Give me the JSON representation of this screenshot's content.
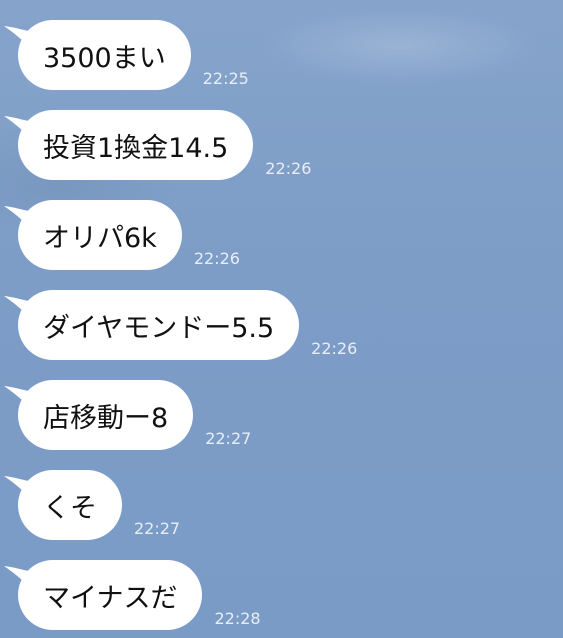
{
  "messages": [
    {
      "text": "3500まい",
      "time": "22:25"
    },
    {
      "text": "投資1換金14.5",
      "time": "22:26"
    },
    {
      "text": "オリパ6k",
      "time": "22:26"
    },
    {
      "text": "ダイヤモンドー5.5",
      "time": "22:26"
    },
    {
      "text": "店移動ー8",
      "time": "22:27"
    },
    {
      "text": "くそ",
      "time": "22:27"
    },
    {
      "text": "マイナスだ",
      "time": "22:28"
    }
  ],
  "colors": {
    "background": "#7d9dc7",
    "bubble": "#ffffff",
    "timestamp": "#e8eef7"
  }
}
